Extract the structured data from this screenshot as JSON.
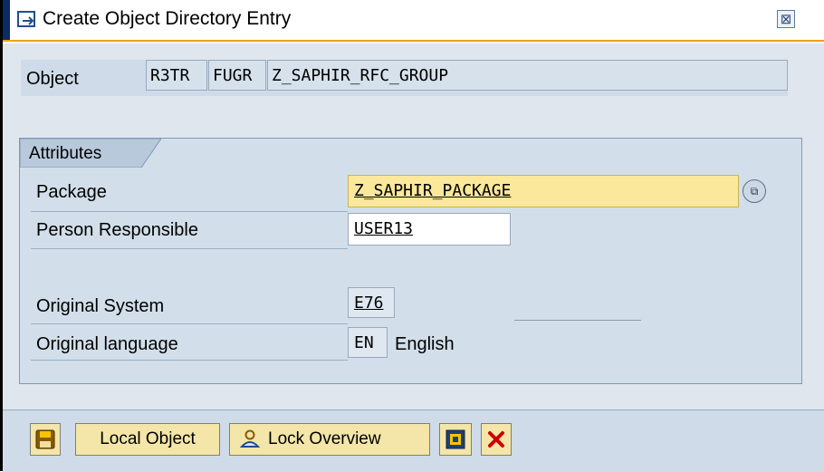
{
  "window": {
    "title": "Create Object Directory Entry"
  },
  "object": {
    "label": "Object",
    "pgmid": "R3TR",
    "type": "FUGR",
    "name": "Z_SAPHIR_RFC_GROUP"
  },
  "attributes": {
    "tab_label": "Attributes",
    "package": {
      "label": "Package",
      "value": "Z_SAPHIR_PACKAGE"
    },
    "person": {
      "label": "Person Responsible",
      "value": "USER13"
    },
    "system": {
      "label": "Original System",
      "value": "E76"
    },
    "language": {
      "label": "Original language",
      "code": "EN",
      "text": "English"
    }
  },
  "toolbar": {
    "save_icon": "save-icon",
    "local_object_label": "Local Object",
    "lock_overview_label": "Lock Overview",
    "display_icon": "object-display-icon",
    "cancel_icon": "cancel-icon"
  },
  "colors": {
    "accent": "#f0a018",
    "package_field": "#fbe89a",
    "button": "#f3e6a8",
    "cancel": "#cc0000"
  }
}
